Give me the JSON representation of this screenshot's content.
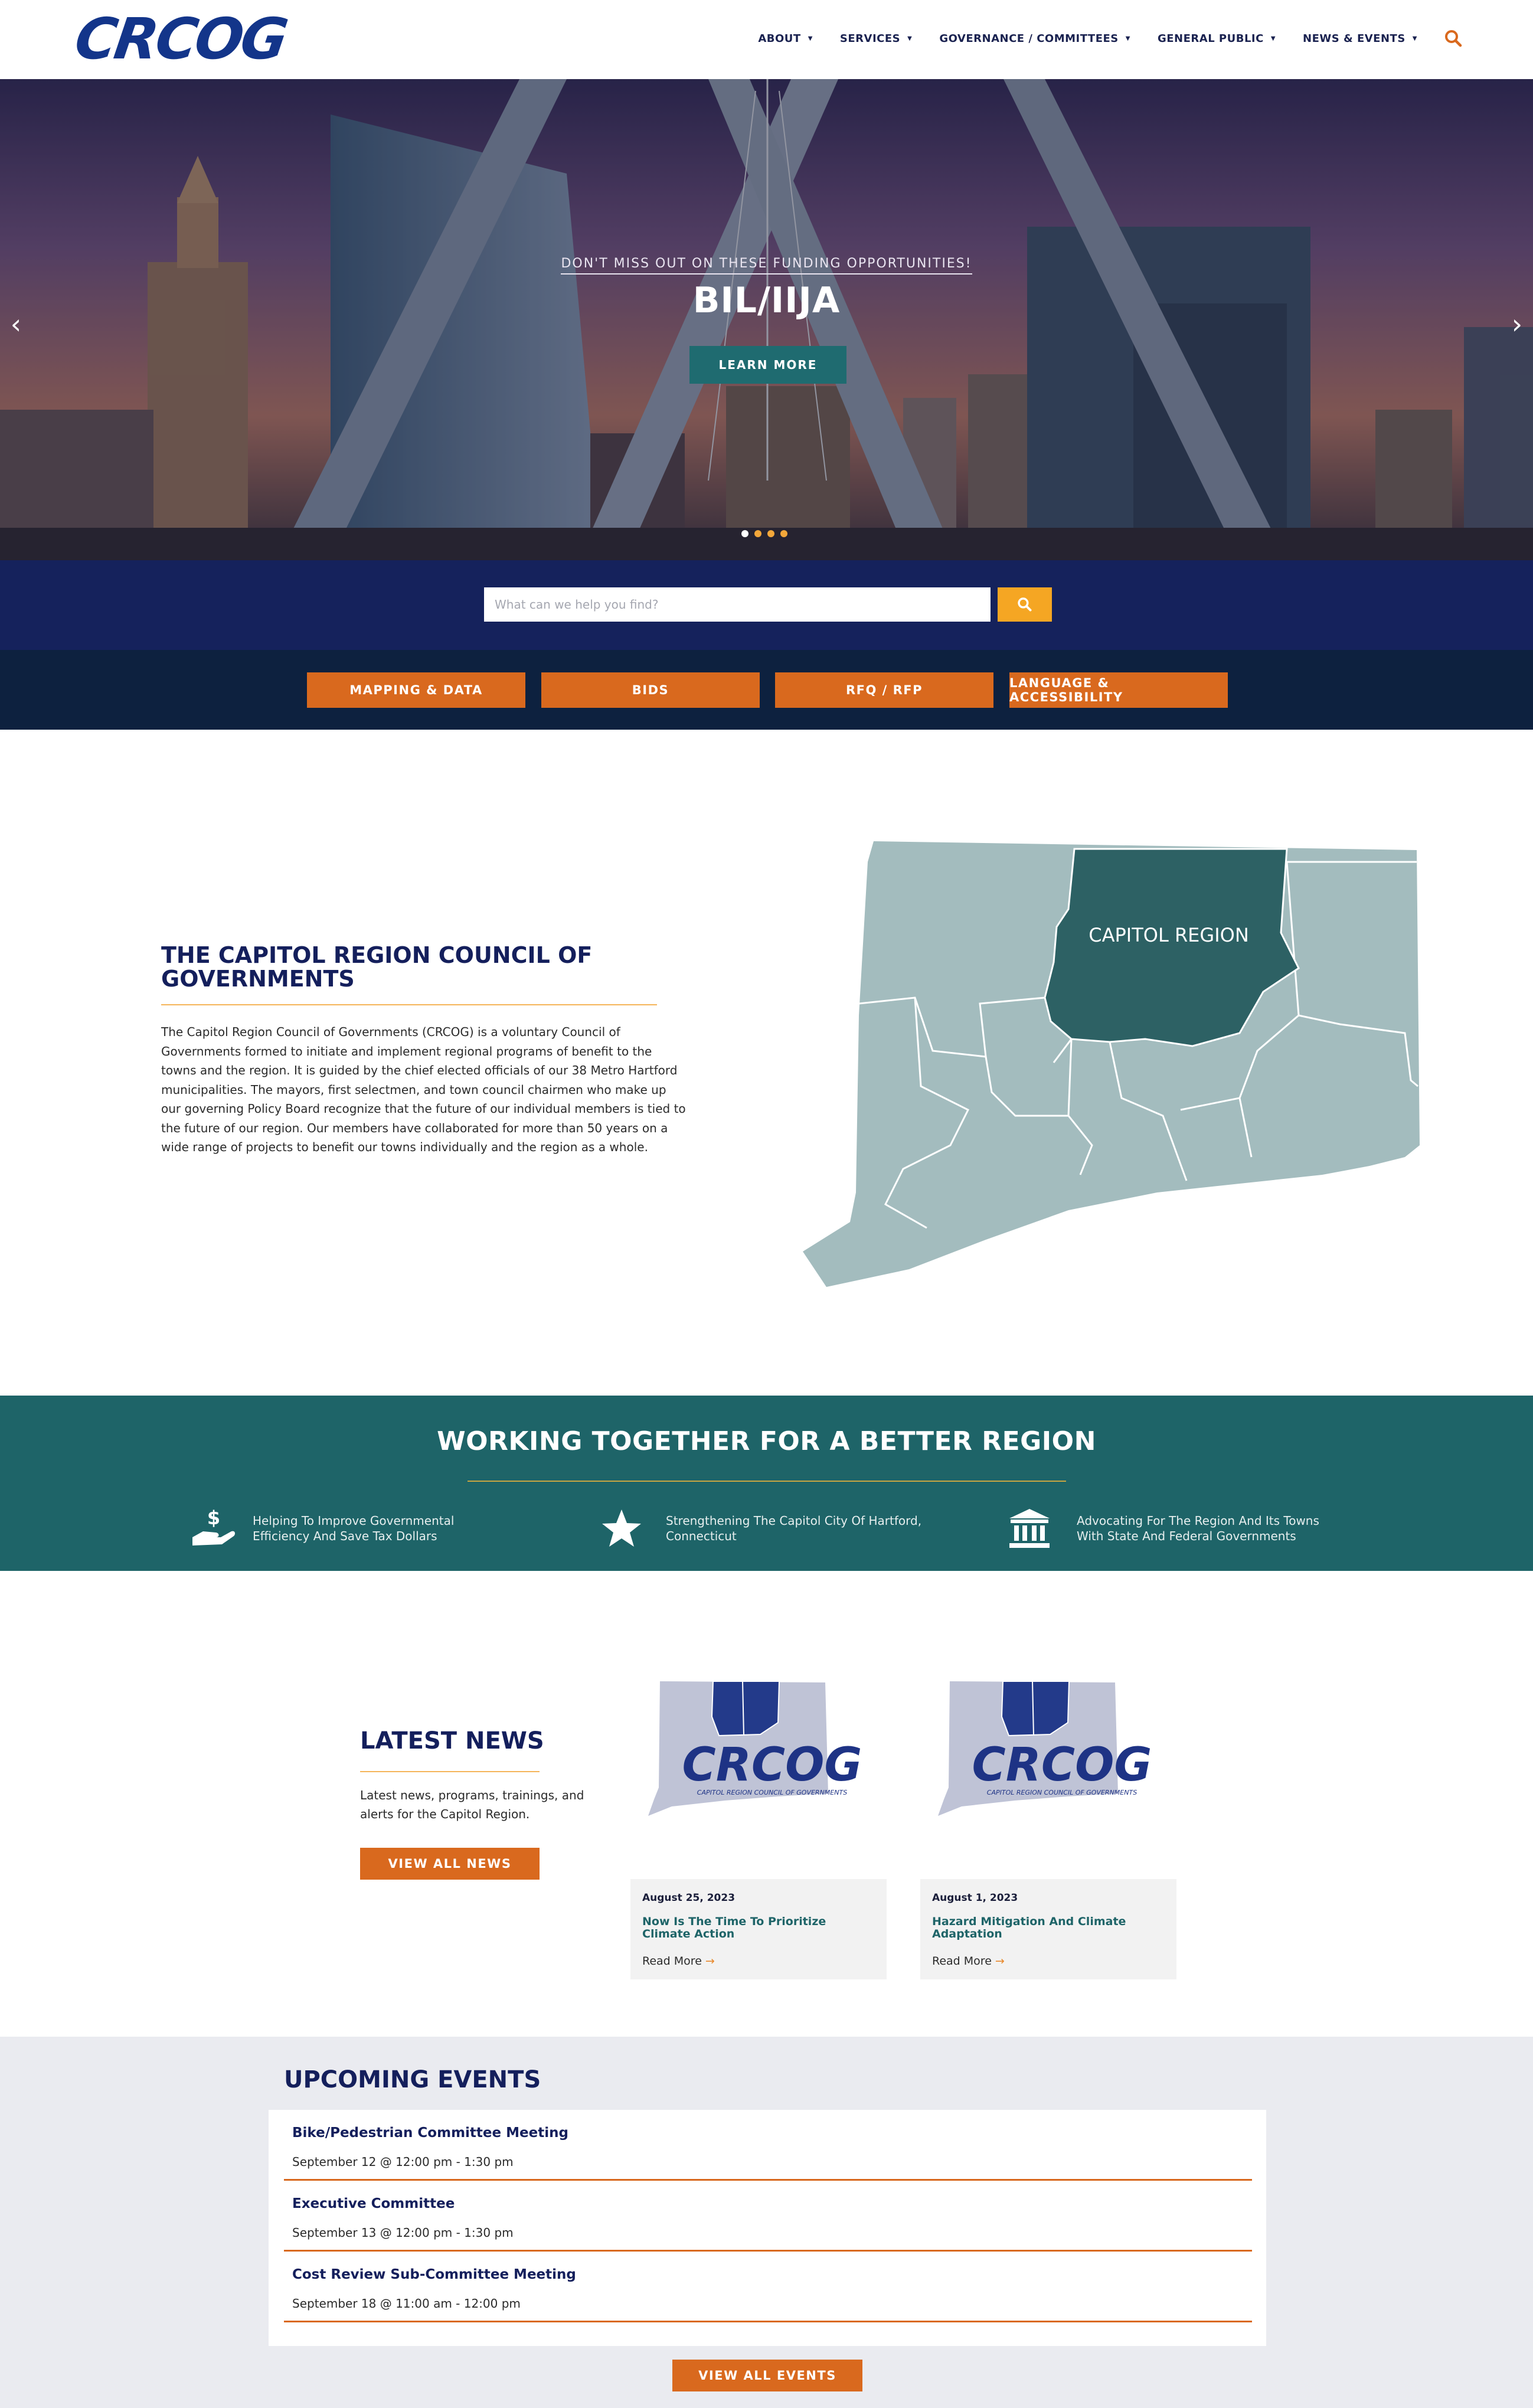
{
  "brand": {
    "logo_text": "CRCOG",
    "primary_color": "#13358a",
    "accent_orange": "#d9691e",
    "accent_yellow": "#f5a623",
    "teal": "#1e6468"
  },
  "nav": {
    "items": [
      {
        "label": "ABOUT"
      },
      {
        "label": "SERVICES"
      },
      {
        "label": "GOVERNANCE / COMMITTEES"
      },
      {
        "label": "GENERAL PUBLIC"
      },
      {
        "label": "NEWS & EVENTS"
      }
    ],
    "search_icon": "search-icon"
  },
  "hero": {
    "subtitle": "DON'T MISS OUT ON THESE FUNDING OPPORTUNITIES!",
    "title": "BIL/IIJA",
    "button": "LEARN MORE",
    "prev_icon": "chevron-left-icon",
    "next_icon": "chevron-right-icon",
    "slide_count": 4,
    "active_slide": 1
  },
  "search": {
    "placeholder": "What can we help you find?",
    "button_icon": "search-icon"
  },
  "quick_links": [
    {
      "label": "MAPPING & DATA"
    },
    {
      "label": "BIDS"
    },
    {
      "label": "RFQ / RFP"
    },
    {
      "label": "LANGUAGE & ACCESSIBILITY"
    }
  ],
  "about": {
    "title": "THE CAPITOL REGION COUNCIL OF GOVERNMENTS",
    "body": "The Capitol Region Council of Governments (CRCOG) is a voluntary Council of Governments formed to initiate and implement regional programs of benefit to the towns and the region. It is guided by the chief elected officials of our 38 Metro Hartford municipalities. The mayors, first selectmen, and town council chairmen who make up our governing Policy Board recognize that the future of our individual members is tied to the future of our region. Our members have collaborated for more than 50 years on a wide range of projects to benefit our towns individually and the region as a whole.",
    "map_label": "CAPITOL REGION"
  },
  "working": {
    "title": "WORKING TOGETHER FOR A BETTER REGION",
    "items": [
      {
        "icon": "hand-dollar-icon",
        "text": "Helping To Improve Governmental Efficiency And Save Tax Dollars"
      },
      {
        "icon": "star-icon",
        "text": "Strengthening The Capitol City Of Hartford, Connecticut"
      },
      {
        "icon": "government-building-icon",
        "text": "Advocating For The Region And Its Towns With State And Federal Governments"
      }
    ]
  },
  "news": {
    "title": "LATEST NEWS",
    "description": "Latest news, programs, trainings, and alerts for the Capitol Region.",
    "button": "VIEW ALL NEWS",
    "image_logo_text": "CRCOG",
    "image_logo_tagline": "CAPITOL REGION COUNCIL OF GOVERNMENTS",
    "cards": [
      {
        "date": "August 25, 2023",
        "headline": "Now Is The Time To Prioritize Climate Action",
        "more": "Read More"
      },
      {
        "date": "August 1, 2023",
        "headline": "Hazard Mitigation And Climate Adaptation",
        "more": "Read More"
      }
    ]
  },
  "events": {
    "title": "UPCOMING EVENTS",
    "items": [
      {
        "name": "Bike/Pedestrian Committee Meeting",
        "time": "September 12 @ 12:00 pm - 1:30 pm"
      },
      {
        "name": "Executive Committee",
        "time": "September 13 @ 12:00 pm - 1:30 pm"
      },
      {
        "name": "Cost Review Sub-Committee Meeting",
        "time": "September 18 @ 11:00 am - 12:00 pm"
      }
    ],
    "button": "VIEW ALL EVENTS"
  }
}
